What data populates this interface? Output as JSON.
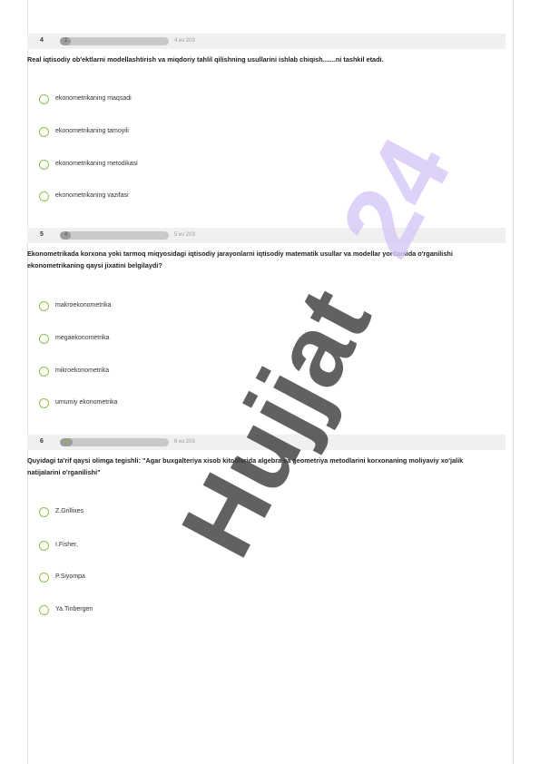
{
  "questions": [
    {
      "number": "4",
      "progress_value": "1",
      "progress_fraction": 0.1,
      "out_of": "4 из 203",
      "text": "Real iqtisodiy ob'ektlarni modellashtirish va miqdoriy tahlil qilishning usullarini ishlab chiqish.......ni tashkil etadi.",
      "options": [
        "ekonometrikaning maqsadi",
        "ekonometrikaning tamoyili",
        "ekonometrikaning metodikasi",
        "ekonometrikaning vazifasi"
      ]
    },
    {
      "number": "5",
      "progress_value": "4",
      "progress_fraction": 0.1,
      "out_of": "5 из 203",
      "text": "Ekonometrikada korxona yoki tarmoq miqyosidagi iqtisodiy jarayonlarni iqtisodiy matematik usullar va modellar yordamida o'rganilishi ekonometrikaning qaysi jixatini belgilaydi?",
      "options": [
        "makroekonometrika",
        "megaekonometrika",
        "mikroekonometrika",
        "umumiy ekonometrika"
      ]
    },
    {
      "number": "6",
      "progress_value": "●",
      "progress_fraction": 0.12,
      "out_of": "6 из 203",
      "text": "Quyidagi ta'rif qaysi olimga tegishli: \"Agar buxgalteriya xisob kitoblarida algebra va geometriya  metodlarini korxonaning moliyaviy xo'jalik natijalarini o'rganilishi\"",
      "options": [
        "Z.Grillixes",
        "I.Fisher,",
        "P.Siyompa",
        "Ya.Tinbergen"
      ]
    }
  ],
  "watermark": {
    "text": "Hujjat 24",
    "color_dark": "#3a3a3a",
    "color_light": "#d6c7f7"
  },
  "colors": {
    "radio": "#8bc34a",
    "bar": "#f0f0f0"
  }
}
